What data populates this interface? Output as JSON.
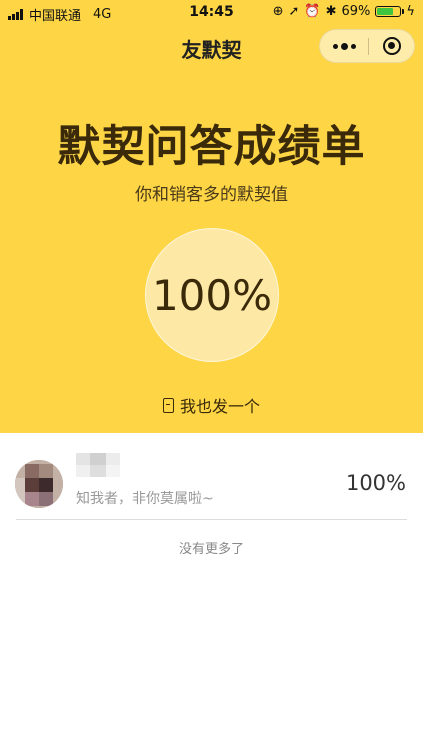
{
  "status": {
    "carrier": "中国联通",
    "network": "4G",
    "time": "14:45",
    "battery_percent": "69%",
    "battery_level": 0.69
  },
  "nav": {
    "title": "友默契",
    "more_icon": "more-dots-icon",
    "close_icon": "target-close-icon"
  },
  "hero": {
    "title": "默契问答成绩单",
    "subtitle": "你和销客多的默契值",
    "score": "100%",
    "share_label": "我也发一个",
    "share_icon": "envelope-icon"
  },
  "list": {
    "items": [
      {
        "note": "知我者，非你莫属啦~",
        "score": "100%"
      }
    ],
    "footer": "没有更多了"
  },
  "colors": {
    "accent": "#fdd545",
    "circle": "#fde9a5",
    "text_dark": "#3a2a0a"
  }
}
